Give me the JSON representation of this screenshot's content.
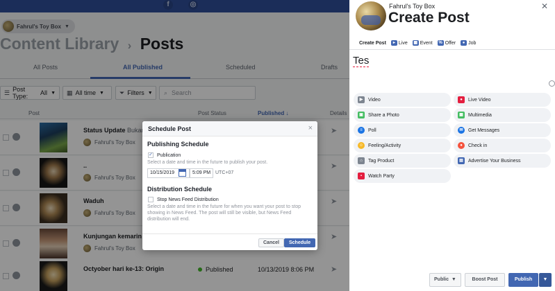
{
  "background": {
    "page_name": "Fahrul's Toy Box",
    "section": "Content Library",
    "current": "Posts",
    "tabs": [
      "All Posts",
      "All Published",
      "Scheduled",
      "Drafts"
    ],
    "filters": {
      "post_type_label": "Post Type:",
      "post_type_value": "All",
      "time": "All time",
      "filters": "Filters",
      "search_placeholder": "Search"
    },
    "columns": {
      "post": "Post",
      "status": "Post Status",
      "published": "Published ↓",
      "details": "Details"
    },
    "rows": [
      {
        "title": "Status Update",
        "extra": " Bukan e",
        "author": "Fahrul's Toy Box",
        "status": "",
        "date": ""
      },
      {
        "title": "..",
        "extra": "",
        "author": "Fahrul's Toy Box",
        "status": "",
        "date": ""
      },
      {
        "title": "Waduh",
        "extra": "",
        "author": "Fahrul's Toy Box",
        "status": "",
        "date": ""
      },
      {
        "title": "Kunjungan kemarin",
        "extra": "",
        "author": "Fahrul's Toy Box",
        "status": "",
        "date": ""
      },
      {
        "title": "Octyober hari ke-13: Origin",
        "extra": "",
        "author": "",
        "status": "Published",
        "date": "10/13/2019 8:06 PM"
      }
    ]
  },
  "modal": {
    "title": "Schedule Post",
    "publishing_title": "Publishing Schedule",
    "publication_label": "Publication",
    "publication_help": "Select a date and time in the future to publish your post.",
    "date": "10/15/2019",
    "time": "5:09 PM",
    "timezone": "UTC+07",
    "distribution_title": "Distribution Schedule",
    "stop_label": "Stop News Feed Distribution",
    "stop_help": "Select a date and time in the future for when you want your post to stop showing in News Feed. The post will still be visible, but News Feed distribution will end.",
    "cancel": "Cancel",
    "schedule": "Schedule"
  },
  "panel": {
    "page_name": "Fahrul's Toy Box",
    "title": "Create Post",
    "tools": [
      "Create Post",
      "Live",
      "Event",
      "Offer",
      "Job"
    ],
    "post_text": "Tes",
    "options_left": [
      "Video",
      "Share a Photo",
      "Poll",
      "Feeling/Activity",
      "Tag Product",
      "Watch Party"
    ],
    "options_right": [
      "Live Video",
      "Multimedia",
      "Get Messages",
      "Check in",
      "Advertise Your Business"
    ],
    "audience": "Public",
    "boost": "Boost Post",
    "publish": "Publish"
  }
}
